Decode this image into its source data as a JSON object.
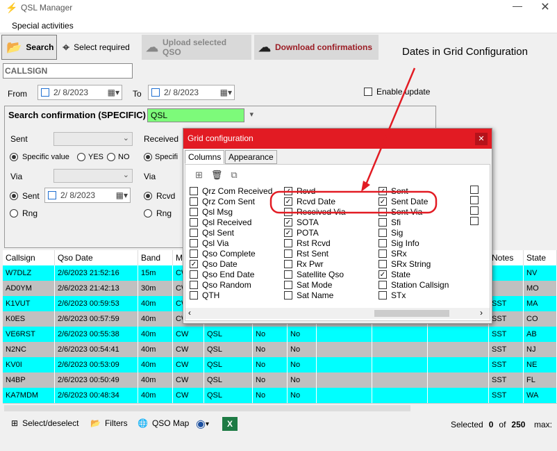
{
  "app": {
    "title": "QSL Manager",
    "icon": "antenna-icon"
  },
  "menu": {
    "special": "Special activities"
  },
  "toolbar": {
    "search": "Search",
    "select_required": "Select required",
    "upload": "Upload selected QSO",
    "download": "Download confirmations"
  },
  "callsign": "CALLSIGN",
  "dates": {
    "from_label": "From",
    "from": "2/ 8/2023",
    "to_label": "To",
    "to": "2/ 8/2023",
    "enable_update": "Enable update"
  },
  "search": {
    "title": "Search confirmation (SPECIFIC)",
    "mode": "QSL",
    "sent": "Sent",
    "received": "Received",
    "specific": "Specific value",
    "yes": "YES",
    "no": "NO",
    "specific_short": "Specifi",
    "via": "Via",
    "sent_radio": "Sent",
    "sent_date": "2/ 8/2023",
    "rcvd": "Rcvd",
    "rng": "Rng"
  },
  "annotation": "Dates in Grid Configuration",
  "dialog": {
    "title": "Grid configuration",
    "tab_columns": "Columns",
    "tab_appearance": "Appearance",
    "columns": [
      [
        "Qrz Com Received",
        "Qrz Com Sent",
        "Qsl Msg",
        "Qsl Received",
        "Qsl Sent",
        "Qsl Via",
        "Qso Complete",
        "Qso Date",
        "Qso End Date",
        "Qso Random",
        "QTH"
      ],
      [
        "Rcvd",
        "Rcvd Date",
        "Received Via",
        "SOTA",
        "POTA",
        "Rst Rcvd",
        "Rst Sent",
        "Rx Pwr",
        "Satellite Qso",
        "Sat Mode",
        "Sat Name"
      ],
      [
        "Sent",
        "Sent Date",
        "Sent Via",
        "Sfi",
        "Sig",
        "Sig Info",
        "SRx",
        "SRx String",
        "State",
        "Station Callsign",
        "STx"
      ]
    ],
    "checked": [
      [
        false,
        false,
        false,
        false,
        false,
        false,
        false,
        true,
        false,
        false,
        false
      ],
      [
        true,
        true,
        false,
        true,
        true,
        false,
        false,
        false,
        false,
        false,
        false
      ],
      [
        true,
        true,
        false,
        false,
        false,
        false,
        false,
        false,
        true,
        false,
        false
      ]
    ]
  },
  "grid": {
    "headers": [
      "Callsign",
      "Qso Date",
      "Band",
      "M",
      "",
      "",
      "",
      "",
      "",
      "",
      "Notes",
      "State"
    ],
    "rows": [
      [
        "W7DLZ",
        "2/6/2023 21:52:16",
        "15m",
        "CW",
        "",
        "",
        "",
        "",
        "",
        "",
        "",
        "NV"
      ],
      [
        "AD0YM",
        "2/6/2023 21:42:13",
        "30m",
        "CW",
        "",
        "",
        "",
        "",
        "",
        "",
        "",
        "MO"
      ],
      [
        "K1VUT",
        "2/6/2023 00:59:53",
        "40m",
        "CW",
        "",
        "",
        "",
        "",
        "",
        "",
        "SST",
        "MA"
      ],
      [
        "K0ES",
        "2/6/2023 00:57:59",
        "40m",
        "CW",
        "",
        "",
        "",
        "",
        "",
        "",
        "SST",
        "CO"
      ],
      [
        "VE6RST",
        "2/6/2023 00:55:38",
        "40m",
        "CW",
        "QSL",
        "No",
        "No",
        "",
        "",
        "",
        "SST",
        "AB"
      ],
      [
        "N2NC",
        "2/6/2023 00:54:41",
        "40m",
        "CW",
        "QSL",
        "No",
        "No",
        "",
        "",
        "",
        "SST",
        "NJ"
      ],
      [
        "KV0I",
        "2/6/2023 00:53:09",
        "40m",
        "CW",
        "QSL",
        "No",
        "No",
        "",
        "",
        "",
        "SST",
        "NE"
      ],
      [
        "N4BP",
        "2/6/2023 00:50:49",
        "40m",
        "CW",
        "QSL",
        "No",
        "No",
        "",
        "",
        "",
        "SST",
        "FL"
      ],
      [
        "KA7MDM",
        "2/6/2023 00:48:34",
        "40m",
        "CW",
        "QSL",
        "No",
        "No",
        "",
        "",
        "",
        "SST",
        "WA"
      ]
    ]
  },
  "status": {
    "select": "Select/deselect",
    "filters": "Filters",
    "qso_map": "QSO Map",
    "selected": "Selected",
    "count": "0",
    "of": "of",
    "total": "250",
    "max": "max:"
  },
  "colors": {
    "cyan": "#00ffff",
    "gray": "#c0c0c0",
    "dialog_red": "#e21b23",
    "highlight": "#e21b23"
  }
}
